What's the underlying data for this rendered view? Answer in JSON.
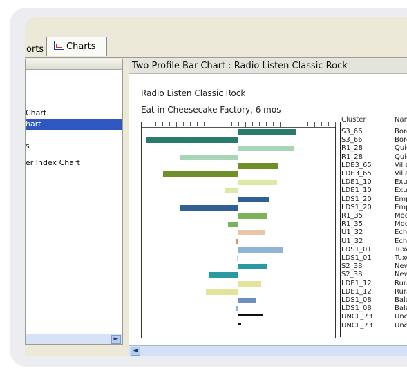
{
  "tabs": [
    {
      "label": "orts"
    },
    {
      "label": "Charts",
      "icon": "chart-icon"
    }
  ],
  "sidebar": {
    "items": [
      {
        "label": "Chart"
      },
      {
        "label": "hart",
        "selected": true
      },
      {
        "label": "s"
      },
      {
        "label": "er Index Chart"
      }
    ]
  },
  "panel": {
    "title": "Two Profile Bar Chart : Radio Listen Classic Rock"
  },
  "chart_data": {
    "type": "bar",
    "title": "Radio Listen Classic Rock",
    "subtitle": "Eat in Cheesecake Factory, 6 mos",
    "columns": [
      "Cluster",
      "Nam"
    ],
    "categories": [
      "S3_66",
      "S3_66",
      "R1_28",
      "R1_28",
      "LDE3_65",
      "LDE3_65",
      "LDE1_10",
      "LDE1_10",
      "LDS1_20",
      "LDS1_20",
      "R1_35",
      "R1_35",
      "U1_32",
      "U1_32",
      "LDS1_01",
      "LDS1_01",
      "S2_38",
      "S2_38",
      "LDE1_12",
      "LDE1_12",
      "LDS1_08",
      "LDS1_08",
      "UNCL_73",
      "UNCL_73"
    ],
    "names": [
      "Boro",
      "Boro",
      "Quie",
      "Quie",
      "Villa",
      "Villa",
      "Exur",
      "Exur",
      "Emp",
      "Emp",
      "Mod",
      "Mod",
      "Echo",
      "Echo",
      "Tuxe",
      "Tuxe",
      "New",
      "New",
      "Rura",
      "Rura",
      "Bala",
      "Bala",
      "Uncl",
      "Uncl"
    ],
    "values": [
      60,
      -95,
      58,
      -60,
      42,
      -78,
      40,
      -14,
      32,
      -60,
      30,
      -10,
      28,
      -2,
      46,
      -1,
      30,
      -30,
      24,
      -33,
      18,
      -2,
      26,
      3
    ],
    "colors": [
      "#2a7a6f",
      "#2a7a6f",
      "#a8d4b8",
      "#a8d4b8",
      "#6f8f2a",
      "#6f8f2a",
      "#dbe8a8",
      "#dbe8a8",
      "#2f5f94",
      "#2f5f94",
      "#7ab35a",
      "#7ab35a",
      "#e8c4a8",
      "#d9956a",
      "#8fb4d4",
      "#b8d0ea",
      "#2a9aa0",
      "#2a9aa0",
      "#e3e39a",
      "#e3e39a",
      "#6f8fbf",
      "#8fb4d8",
      "#111111",
      "#111111"
    ],
    "xlim": [
      -100,
      100
    ],
    "grid": false
  }
}
